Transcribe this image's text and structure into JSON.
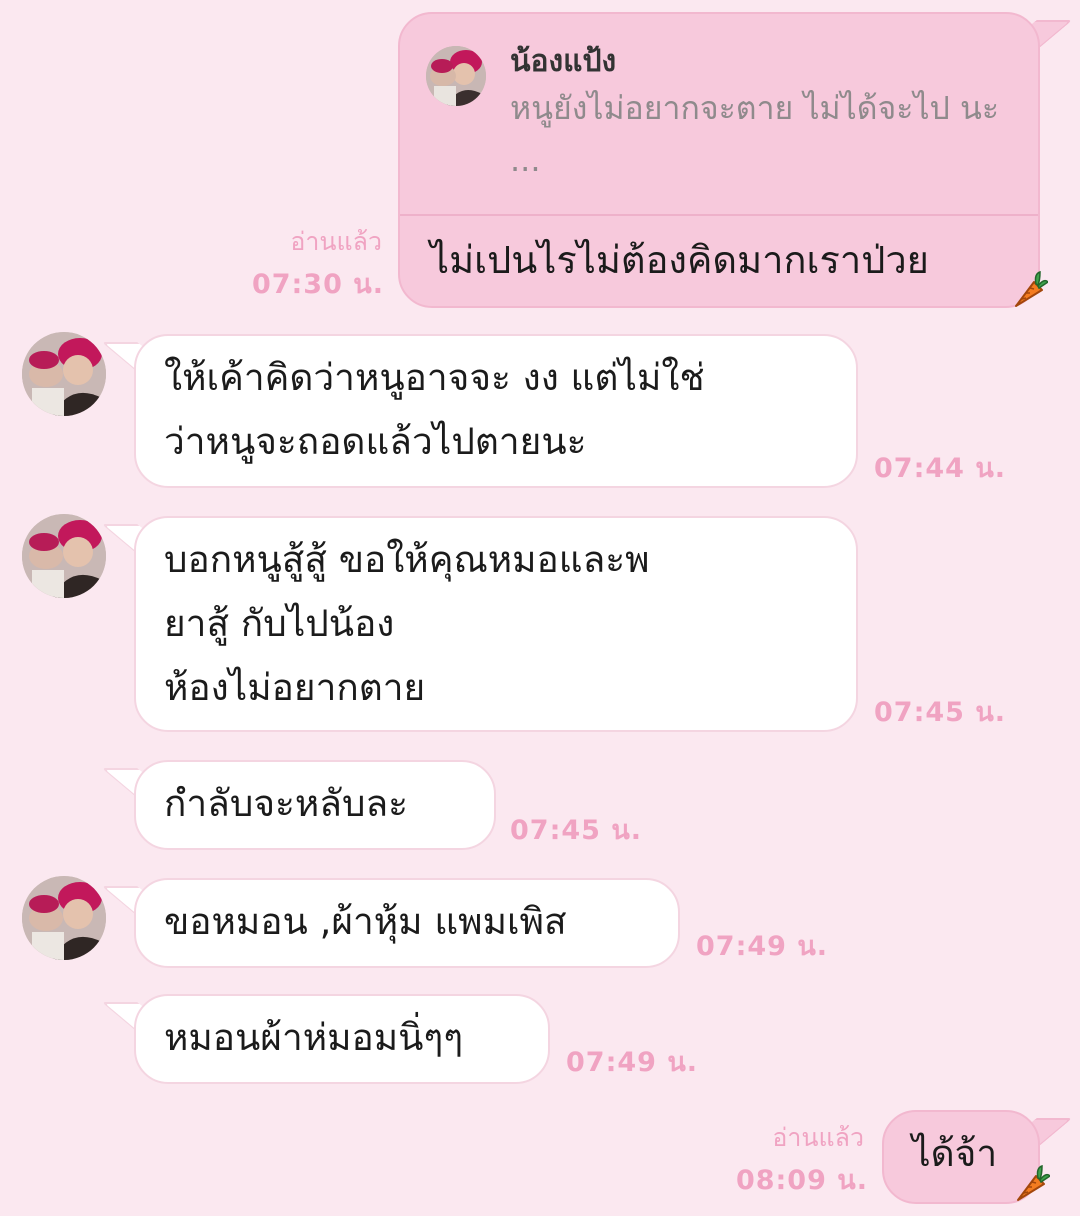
{
  "reply": {
    "quote_name": "น้องแป้ง",
    "quote_text": "หนูยังไม่อยากจะตาย ไม่ได้จะไป นะ ...",
    "message": "ไม่เปนไรไม่ต้องคิดมากเราป่วย",
    "read_label": "อ่านแล้ว",
    "time": "07:30 น."
  },
  "messages": [
    {
      "lines": [
        "ให้เค้าคิดว่าหนูอาจจะ งง  แต่ไม่ใช่",
        "ว่าหนูจะถอดแล้วไปตายนะ"
      ],
      "time": "07:44 น."
    },
    {
      "lines": [
        "บอกหนูสู้สู้  ขอให้คุณหมอและพ",
        "ยาสู้ กับไปน้อง",
        "ห้องไม่อยากตาย"
      ],
      "time": "07:45 น."
    },
    {
      "lines": [
        "กำลับจะหลับละ"
      ],
      "time": "07:45 น."
    },
    {
      "lines": [
        "ขอหมอน ,ผ้าหุ้ม แพมเพิส"
      ],
      "time": "07:49 น."
    },
    {
      "lines": [
        "หมอนผ้าห่มอมนิ่ๆๆ"
      ],
      "time": "07:49 น."
    }
  ],
  "last_reply": {
    "message": "ได้จ้า",
    "read_label": "อ่านแล้ว",
    "time": "08:09 น."
  },
  "colors": {
    "background": "#fbe8f0",
    "outgoing_bubble": "#f7c9dc",
    "incoming_bubble": "#ffffff",
    "timestamp": "#f0a3c2"
  },
  "icons": {
    "sticker": "carrot-icon",
    "avatar": "contact-avatar"
  }
}
